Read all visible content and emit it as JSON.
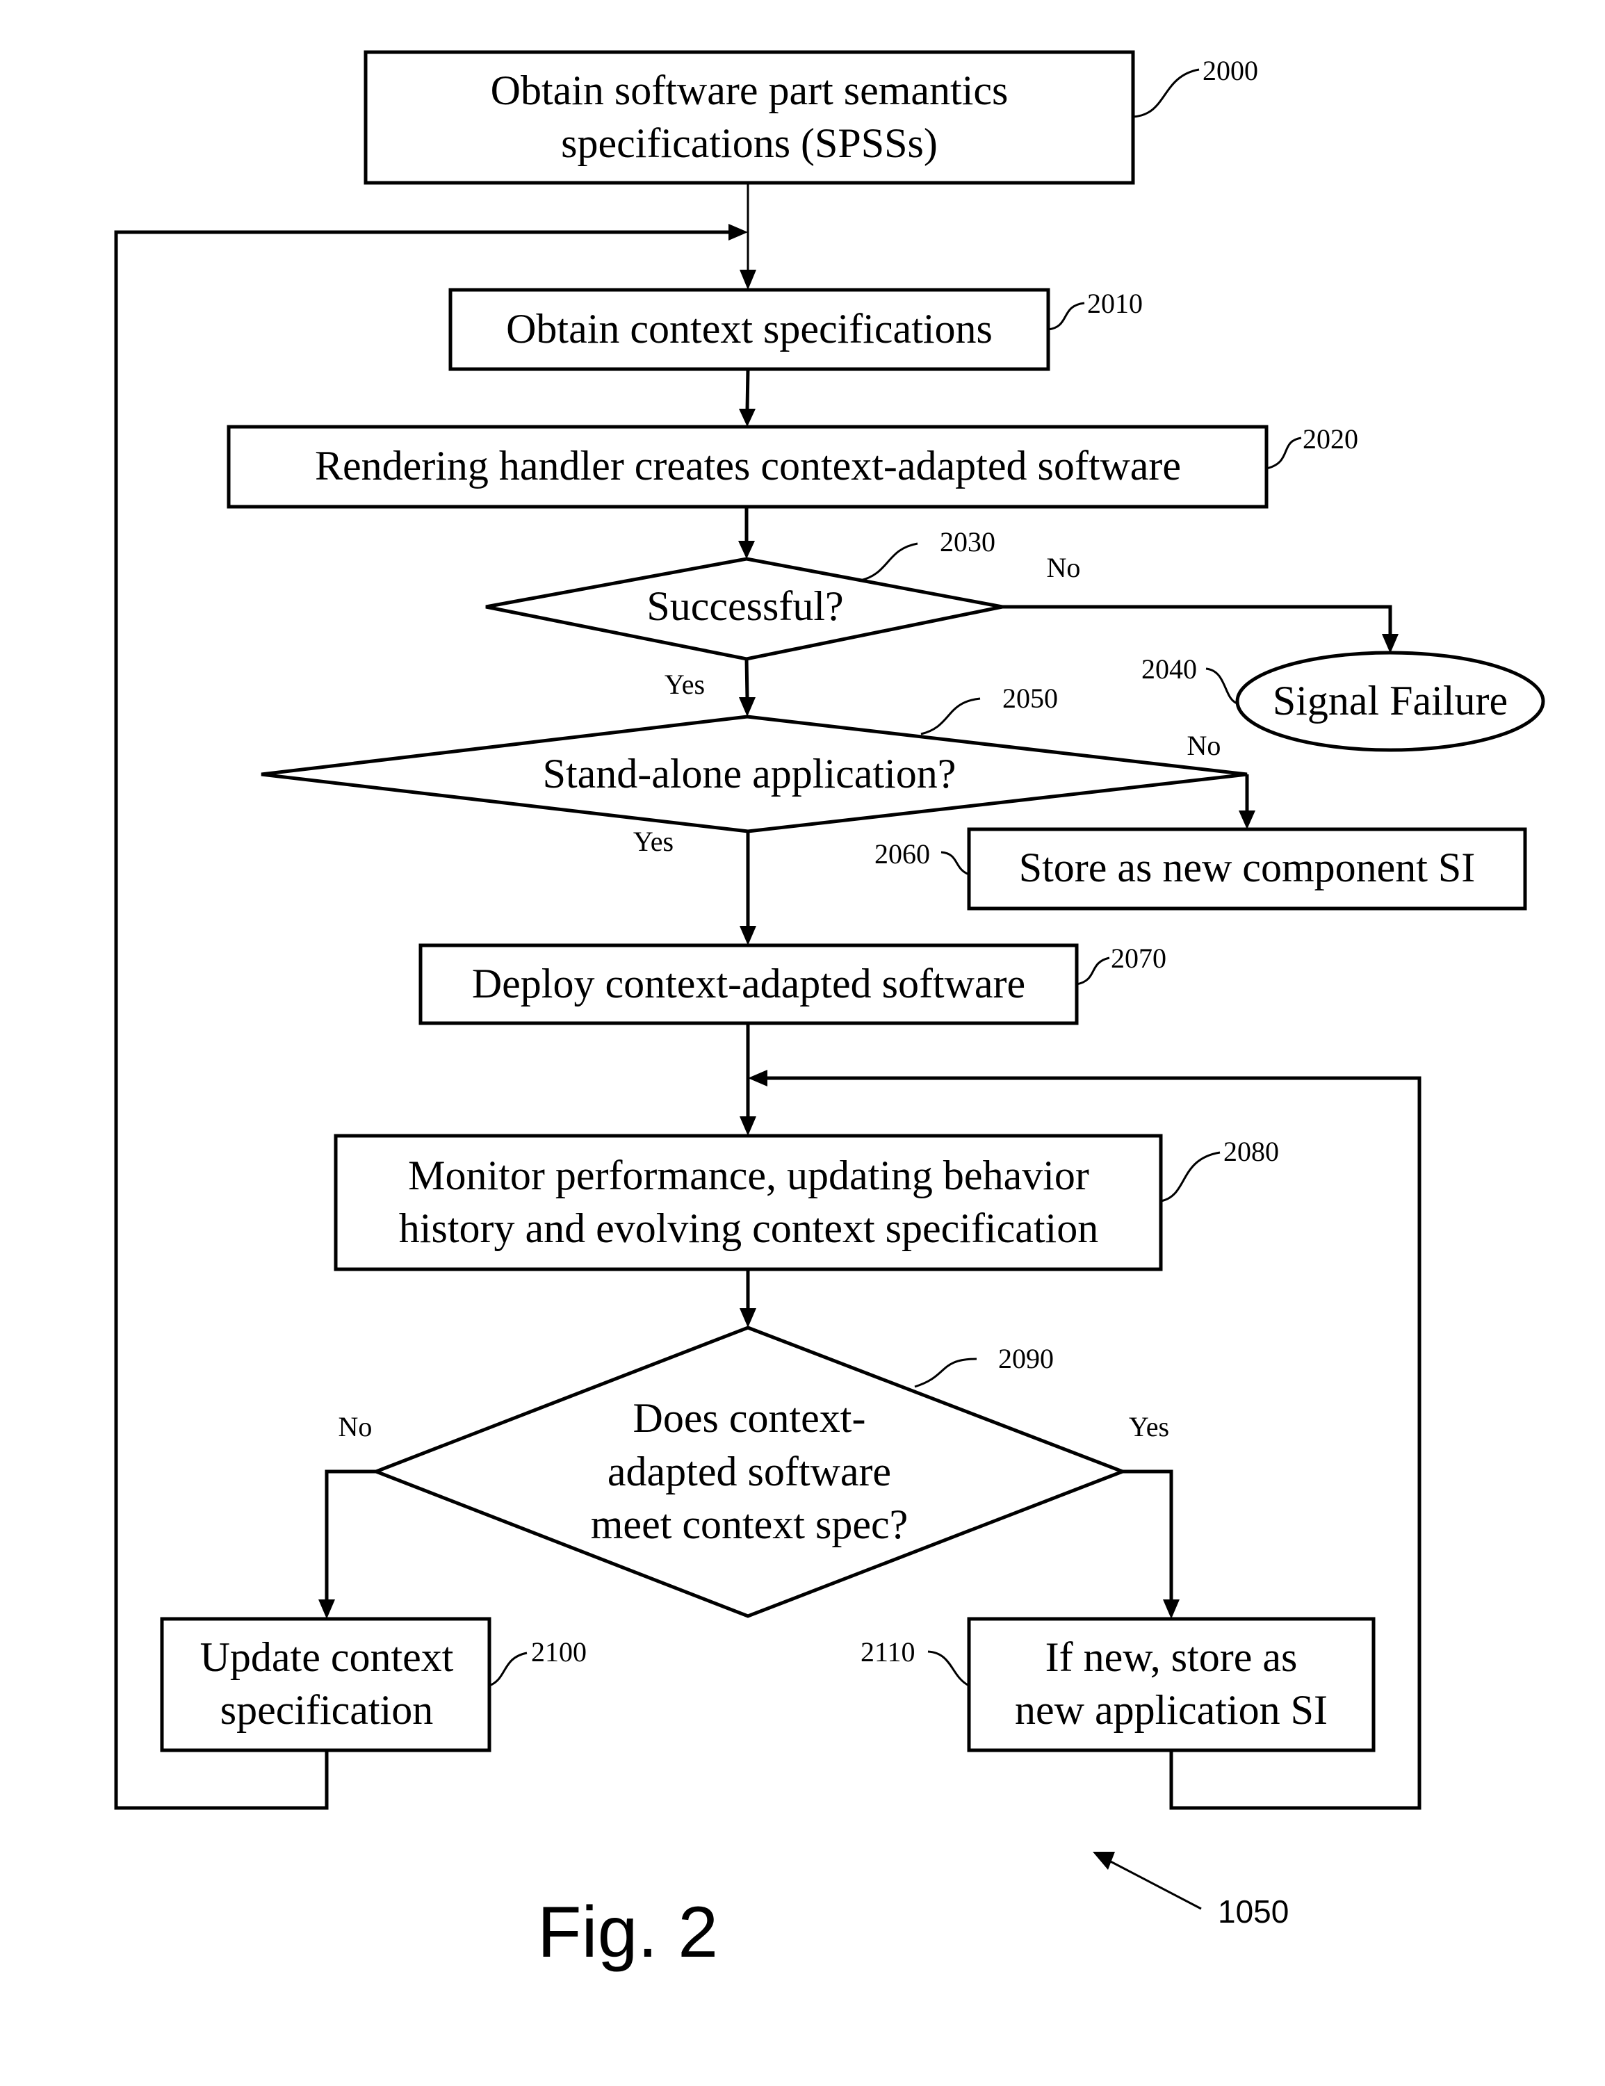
{
  "figure": {
    "caption": "Fig. 2",
    "reference": "1050"
  },
  "nodes": {
    "n2000": {
      "ref": "2000",
      "lines": [
        "Obtain software part semantics",
        "specifications (SPSSs)"
      ]
    },
    "n2010": {
      "ref": "2010",
      "lines": [
        "Obtain context specifications"
      ]
    },
    "n2020": {
      "ref": "2020",
      "lines": [
        "Rendering handler creates context-adapted software"
      ]
    },
    "n2030": {
      "ref": "2030",
      "lines": [
        "Successful?"
      ]
    },
    "n2040": {
      "ref": "2040",
      "lines": [
        "Signal Failure"
      ]
    },
    "n2050": {
      "ref": "2050",
      "lines": [
        "Stand-alone application?"
      ]
    },
    "n2060": {
      "ref": "2060",
      "lines": [
        "Store as new component SI"
      ]
    },
    "n2070": {
      "ref": "2070",
      "lines": [
        "Deploy context-adapted software"
      ]
    },
    "n2080": {
      "ref": "2080",
      "lines": [
        "Monitor performance, updating behavior",
        "history and evolving context specification"
      ]
    },
    "n2090": {
      "ref": "2090",
      "lines": [
        "Does context-",
        "adapted software",
        "meet context spec?"
      ]
    },
    "n2100": {
      "ref": "2100",
      "lines": [
        "Update context",
        "specification"
      ]
    },
    "n2110": {
      "ref": "2110",
      "lines": [
        "If new, store as",
        "new application SI"
      ]
    }
  },
  "branches": {
    "b2030_no": "No",
    "b2030_yes": "Yes",
    "b2050_no": "No",
    "b2050_yes": "Yes",
    "b2090_no": "No",
    "b2090_yes": "Yes"
  }
}
